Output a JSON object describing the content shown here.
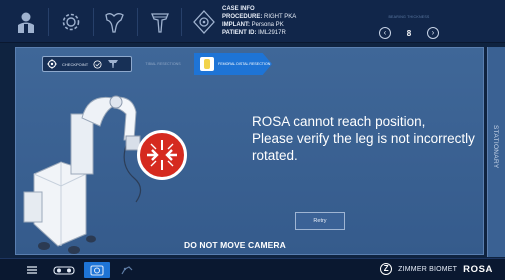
{
  "top_bar": {
    "icons": [
      {
        "name": "patient-icon",
        "label": ""
      },
      {
        "name": "settings-gear-icon",
        "label": ""
      },
      {
        "name": "femur-icon",
        "label": ""
      },
      {
        "name": "tibia-icon",
        "label": ""
      },
      {
        "name": "robot-settings-icon",
        "label": ""
      }
    ],
    "case_info": {
      "title": "CASE INFO",
      "procedure_label": "PROCEDURE:",
      "procedure_value": "RIGHT PKA",
      "implant_label": "IMPLANT:",
      "implant_value": "Persona PK",
      "patient_label": "PATIENT ID:",
      "patient_value": "IML2917R"
    },
    "bearing": {
      "label": "BEARING THICKNESS",
      "value": "8",
      "decrement_symbol": "‹",
      "increment_symbol": "›"
    }
  },
  "stage": {
    "breadcrumbs": {
      "checkpoint": "CHECKPOINT",
      "tibial": "TIBIAL RESECTIONS",
      "femoral": "FEMORAL DISTAL RESECTION"
    },
    "message_line1": "ROSA cannot reach position,",
    "message_line2": "Please verify the leg is not incorrectly rotated.",
    "retry_label": "Retry",
    "do_not_move": "DO NOT MOVE CAMERA",
    "side_tab_label": "STATIONARY"
  },
  "bottom_bar": {
    "brand_company": "ZIMMER BIOMET",
    "brand_product": "ROSA",
    "logo_letter": "Z"
  },
  "colors": {
    "accent_blue": "#1e74d6",
    "warning_red": "#d52a1f",
    "stage_blue": "#3b6296",
    "topbar_navy": "#11264a"
  }
}
